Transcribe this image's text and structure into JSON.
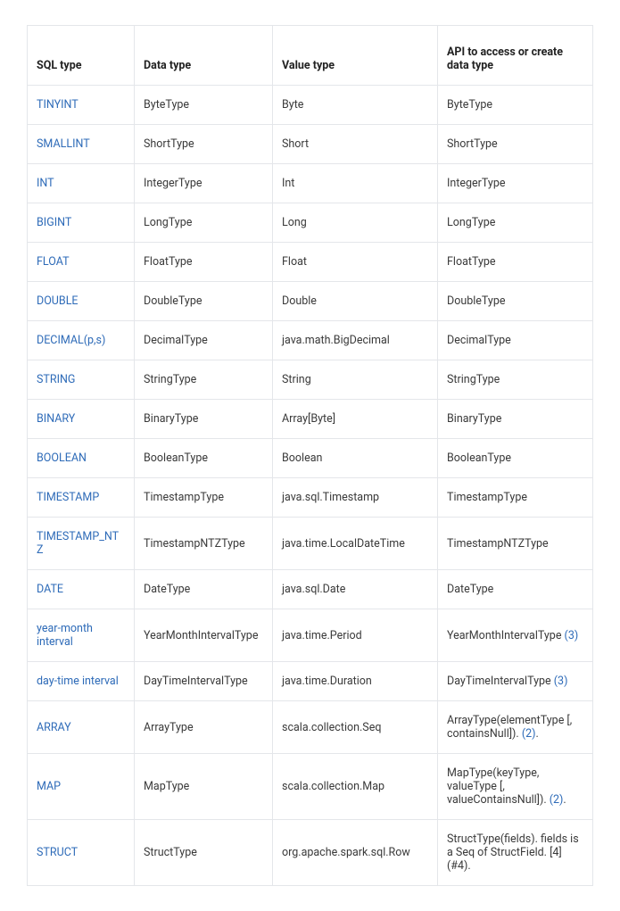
{
  "headers": {
    "sql_type": "SQL type",
    "data_type": "Data type",
    "value_type": "Value type",
    "api": "API to access or create data type"
  },
  "rows": [
    {
      "sql": "TINYINT",
      "data": "ByteType",
      "value": "Byte",
      "api": "ByteType"
    },
    {
      "sql": "SMALLINT",
      "data": "ShortType",
      "value": "Short",
      "api": "ShortType"
    },
    {
      "sql": "INT",
      "data": "IntegerType",
      "value": "Int",
      "api": "IntegerType"
    },
    {
      "sql": "BIGINT",
      "data": "LongType",
      "value": "Long",
      "api": "LongType"
    },
    {
      "sql": "FLOAT",
      "data": "FloatType",
      "value": "Float",
      "api": "FloatType"
    },
    {
      "sql": "DOUBLE",
      "data": "DoubleType",
      "value": "Double",
      "api": "DoubleType"
    },
    {
      "sql": "DECIMAL(p,s)",
      "data": "DecimalType",
      "value": "java.math.BigDecimal",
      "api": "DecimalType"
    },
    {
      "sql": "STRING",
      "data": "StringType",
      "value": "String",
      "api": "StringType"
    },
    {
      "sql": "BINARY",
      "data": "BinaryType",
      "value": "Array[Byte]",
      "api": "BinaryType"
    },
    {
      "sql": "BOOLEAN",
      "data": "BooleanType",
      "value": "Boolean",
      "api": "BooleanType"
    },
    {
      "sql": "TIMESTAMP",
      "data": "TimestampType",
      "value": "java.sql.Timestamp",
      "api": "TimestampType"
    },
    {
      "sql": "TIMESTAMP_NTZ",
      "data": "TimestampNTZType",
      "value": "java.time.LocalDateTime",
      "api": "TimestampNTZType"
    },
    {
      "sql": "DATE",
      "data": "DateType",
      "value": "java.sql.Date",
      "api": "DateType"
    },
    {
      "sql": "year-month interval",
      "data": "YearMonthIntervalType",
      "value": "java.time.Period",
      "api": "YearMonthIntervalType ",
      "note": "(3)"
    },
    {
      "sql": "day-time interval",
      "data": "DayTimeIntervalType",
      "value": "java.time.Duration",
      "api": "DayTimeIntervalType ",
      "note": "(3)"
    },
    {
      "sql": "ARRAY",
      "data": "ArrayType",
      "value": "scala.collection.Seq",
      "api": "ArrayType(elementType [, containsNull]). ",
      "note": "(2)",
      "note_suffix": "."
    },
    {
      "sql": "MAP",
      "data": "MapType",
      "value": "scala.collection.Map",
      "api": "MapType(keyType, valueType [, valueContainsNull]). ",
      "note": "(2)",
      "note_suffix": "."
    },
    {
      "sql": "STRUCT",
      "data": "StructType",
      "value": "org.apache.spark.sql.Row",
      "api": "StructType(fields). fields is a Seq of StructField. [4] (#4)."
    }
  ]
}
